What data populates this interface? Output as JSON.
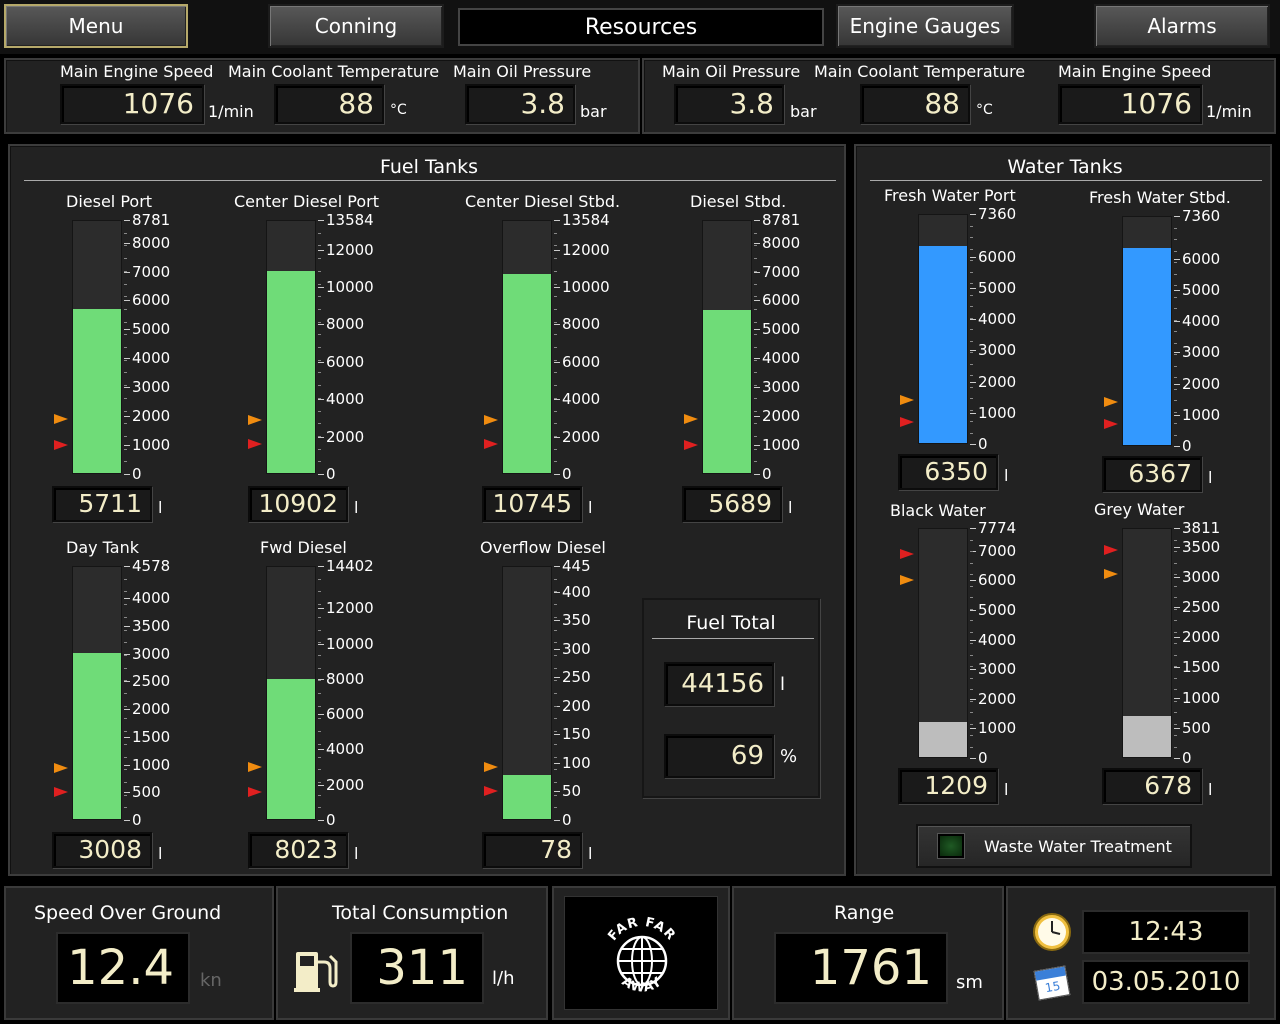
{
  "nav": {
    "menu": "Menu",
    "conning": "Conning",
    "title": "Resources",
    "engine_gauges": "Engine Gauges",
    "alarms": "Alarms"
  },
  "engines": {
    "left": [
      {
        "label": "Main Engine Speed",
        "value": "1076",
        "unit": "1/min"
      },
      {
        "label": "Main Coolant Temperature",
        "value": "88",
        "unit": "°C"
      },
      {
        "label": "Main Oil Pressure",
        "value": "3.8",
        "unit": "bar"
      }
    ],
    "right": [
      {
        "label": "Main Oil Pressure",
        "value": "3.8",
        "unit": "bar"
      },
      {
        "label": "Main Coolant Temperature",
        "value": "88",
        "unit": "°C"
      },
      {
        "label": "Main Engine Speed",
        "value": "1076",
        "unit": "1/min"
      }
    ]
  },
  "fuel": {
    "title": "Fuel Tanks",
    "tanks": [
      {
        "name": "Diesel Port",
        "value": "5711",
        "unit": "l",
        "level": 5711,
        "max": 8781,
        "ticks": [
          "8781",
          "8000",
          "7000",
          "6000",
          "5000",
          "4000",
          "3000",
          "2000",
          "1000",
          "0"
        ],
        "tick_values": [
          8781,
          8000,
          7000,
          6000,
          5000,
          4000,
          3000,
          2000,
          1000,
          0
        ],
        "warn": 1900,
        "alarm": 1000
      },
      {
        "name": "Center Diesel Port",
        "value": "10902",
        "unit": "l",
        "level": 10902,
        "max": 13584,
        "ticks": [
          "13584",
          "12000",
          "10000",
          "8000",
          "6000",
          "4000",
          "2000",
          "0"
        ],
        "tick_values": [
          13584,
          12000,
          10000,
          8000,
          6000,
          4000,
          2000,
          0
        ],
        "warn": 2900,
        "alarm": 1600
      },
      {
        "name": "Center Diesel Stbd.",
        "value": "10745",
        "unit": "l",
        "level": 10745,
        "max": 13584,
        "ticks": [
          "13584",
          "12000",
          "10000",
          "8000",
          "6000",
          "4000",
          "2000",
          "0"
        ],
        "tick_values": [
          13584,
          12000,
          10000,
          8000,
          6000,
          4000,
          2000,
          0
        ],
        "warn": 2900,
        "alarm": 1600
      },
      {
        "name": "Diesel Stbd.",
        "value": "5689",
        "unit": "l",
        "level": 5689,
        "max": 8781,
        "ticks": [
          "8781",
          "8000",
          "7000",
          "6000",
          "5000",
          "4000",
          "3000",
          "2000",
          "1000",
          "0"
        ],
        "tick_values": [
          8781,
          8000,
          7000,
          6000,
          5000,
          4000,
          3000,
          2000,
          1000,
          0
        ],
        "warn": 1900,
        "alarm": 1000
      },
      {
        "name": "Day Tank",
        "value": "3008",
        "unit": "l",
        "level": 3008,
        "max": 4578,
        "ticks": [
          "4578",
          "4000",
          "3500",
          "3000",
          "2500",
          "2000",
          "1500",
          "1000",
          "500",
          "0"
        ],
        "tick_values": [
          4578,
          4000,
          3500,
          3000,
          2500,
          2000,
          1500,
          1000,
          500,
          0
        ],
        "warn": 940,
        "alarm": 500
      },
      {
        "name": "Fwd Diesel",
        "value": "8023",
        "unit": "l",
        "level": 8023,
        "max": 14402,
        "ticks": [
          "14402",
          "12000",
          "10000",
          "8000",
          "6000",
          "4000",
          "2000",
          "0"
        ],
        "tick_values": [
          14402,
          12000,
          10000,
          8000,
          6000,
          4000,
          2000,
          0
        ],
        "warn": 3000,
        "alarm": 1600
      },
      {
        "name": "Overflow Diesel",
        "value": "78",
        "unit": "l",
        "level": 78,
        "max": 445,
        "ticks": [
          "445",
          "400",
          "350",
          "300",
          "250",
          "200",
          "150",
          "100",
          "50",
          "0"
        ],
        "tick_values": [
          445,
          400,
          350,
          300,
          250,
          200,
          150,
          100,
          50,
          0
        ],
        "warn": 92,
        "alarm": 50
      }
    ],
    "total": {
      "title": "Fuel Total",
      "value": "44156",
      "unit": "l",
      "percent": "69",
      "percent_unit": "%"
    }
  },
  "water": {
    "title": "Water Tanks",
    "tanks": [
      {
        "name": "Fresh Water Port",
        "value": "6350",
        "unit": "l",
        "level": 6350,
        "max": 7360,
        "ticks": [
          "7360",
          "6000",
          "5000",
          "4000",
          "3000",
          "2000",
          "1000",
          "0"
        ],
        "tick_values": [
          7360,
          6000,
          5000,
          4000,
          3000,
          2000,
          1000,
          0
        ],
        "warn": 1400,
        "alarm": 700,
        "color": "#3399ff"
      },
      {
        "name": "Fresh Water Stbd.",
        "value": "6367",
        "unit": "l",
        "level": 6367,
        "max": 7360,
        "ticks": [
          "7360",
          "6000",
          "5000",
          "4000",
          "3000",
          "2000",
          "1000",
          "0"
        ],
        "tick_values": [
          7360,
          6000,
          5000,
          4000,
          3000,
          2000,
          1000,
          0
        ],
        "warn": 1400,
        "alarm": 700,
        "color": "#3399ff"
      },
      {
        "name": "Black Water",
        "value": "1209",
        "unit": "l",
        "level": 1209,
        "max": 7774,
        "ticks": [
          "7774",
          "7000",
          "6000",
          "5000",
          "4000",
          "3000",
          "2000",
          "1000",
          "0"
        ],
        "tick_values": [
          7774,
          7000,
          6000,
          5000,
          4000,
          3000,
          2000,
          1000,
          0
        ],
        "warn": 6000,
        "alarm": 6900,
        "color": "#bdbdbd"
      },
      {
        "name": "Grey Water",
        "value": "678",
        "unit": "l",
        "level": 678,
        "max": 3811,
        "ticks": [
          "3811",
          "3500",
          "3000",
          "2500",
          "2000",
          "1500",
          "1000",
          "500",
          "0"
        ],
        "tick_values": [
          3811,
          3500,
          3000,
          2500,
          2000,
          1500,
          1000,
          500,
          0
        ],
        "warn": 3050,
        "alarm": 3450,
        "color": "#bdbdbd"
      }
    ],
    "waste_button": "Waste Water Treatment"
  },
  "status": {
    "sog": {
      "label": "Speed Over Ground",
      "value": "12.4",
      "unit": "kn"
    },
    "consumption": {
      "label": "Total Consumption",
      "value": "311",
      "unit": "l/h"
    },
    "logo": {
      "top": "FAR FAR",
      "bottom": "AWAY"
    },
    "range": {
      "label": "Range",
      "value": "1761",
      "unit": "sm"
    },
    "time": "12:43",
    "date": "03.05.2010",
    "calendar_day": "15"
  },
  "colors": {
    "fuel": "#6fdc78",
    "alarm_marker": "#e02020",
    "warn_marker": "#f08c10"
  }
}
